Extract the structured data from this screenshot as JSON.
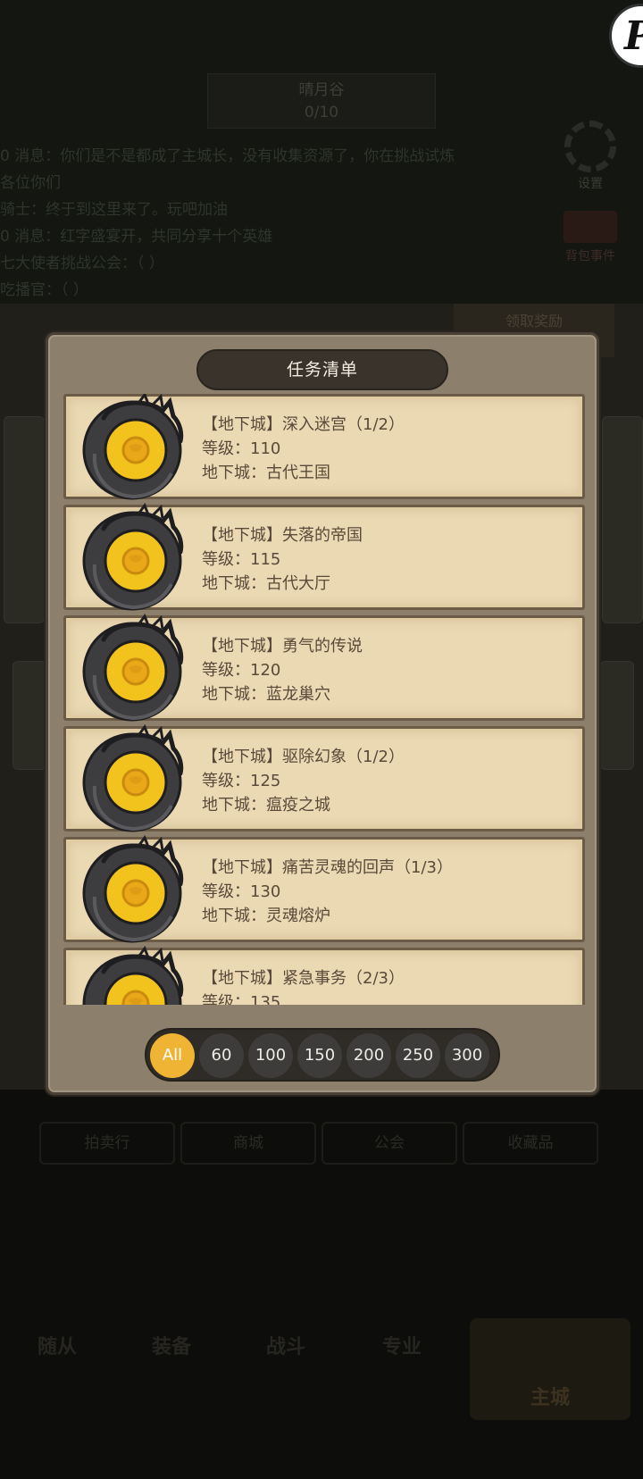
{
  "background": {
    "counter_title": "晴月谷",
    "counter_value": "0/10",
    "chat_lines": [
      "0 消息：你们是不是都成了主城长，没有收集资源了，你在挑战试炼",
      "各位你们",
      "骑士：终于到这里来了。玩吧加油",
      "0 消息：红字盛宴开，共同分享十个英雄",
      "七大使者挑战公会：（ ）",
      "吃播官：（ ）"
    ],
    "settings_label": "设置",
    "bag_label": "背包事件",
    "parch_tab_label": "领取奖励",
    "tabs": [
      "拍卖行",
      "商城",
      "公会",
      "收藏品"
    ],
    "nav": [
      "随从",
      "装备",
      "战斗",
      "专业"
    ],
    "main_button": "主城"
  },
  "dialog": {
    "title": "任务清单",
    "quests": [
      {
        "name": "【地下城】深入迷宫（1/2）",
        "level": "等级：110",
        "dungeon": "地下城：古代王国"
      },
      {
        "name": "【地下城】失落的帝国",
        "level": "等级：115",
        "dungeon": "地下城：古代大厅"
      },
      {
        "name": "【地下城】勇气的传说",
        "level": "等级：120",
        "dungeon": "地下城：蓝龙巢穴"
      },
      {
        "name": "【地下城】驱除幻象（1/2）",
        "level": "等级：125",
        "dungeon": "地下城：瘟疫之城"
      },
      {
        "name": "【地下城】痛苦灵魂的回声（1/3）",
        "level": "等级：130",
        "dungeon": "地下城：灵魂熔炉"
      },
      {
        "name": "【地下城】紧急事务（2/3）",
        "level": "等级：135",
        "dungeon": ""
      }
    ],
    "filters": [
      "All",
      "60",
      "100",
      "150",
      "200",
      "250",
      "300"
    ],
    "active_filter": "All"
  },
  "colors": {
    "modal_bg": "#8c7f6b",
    "parchment": "#ead9b3",
    "title_pill": "#3a332c",
    "filter_active": "#f0b434",
    "filter_inactive": "#3e3c3a",
    "coin": "#f2c21d",
    "dragon_ring": "#3d3d3f"
  }
}
